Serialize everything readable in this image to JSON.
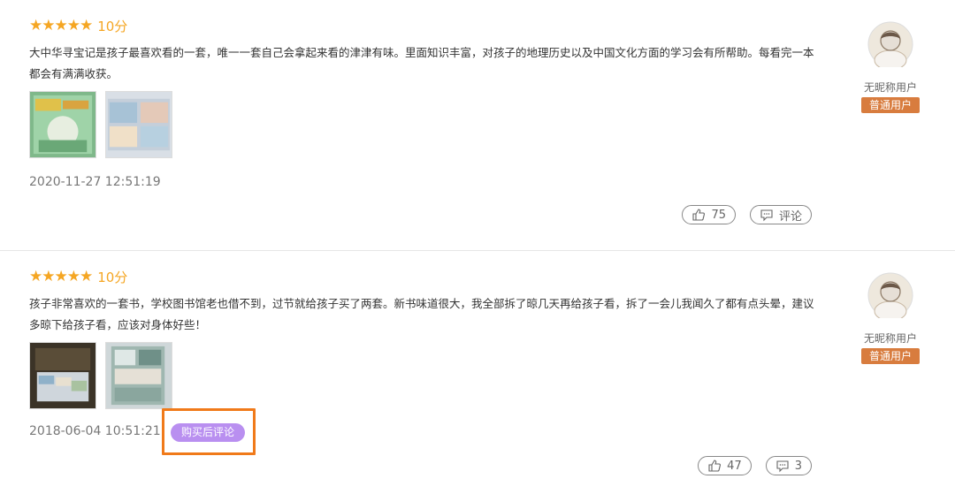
{
  "reviews": [
    {
      "stars": "★★★★★",
      "score": "10分",
      "content": "大中华寻宝记是孩子最喜欢看的一套，唯一一套自己会拿起来看的津津有味。里面知识丰富，对孩子的地理历史以及中国文化方面的学习会有所帮助。每看完一本都会有满满收获。",
      "date": "2020-11-27 12:51:19",
      "likes": "75",
      "comment_label": "评论",
      "user_name": "无昵称用户",
      "user_level": "普通用户"
    },
    {
      "stars": "★★★★★",
      "score": "10分",
      "content": "孩子非常喜欢的一套书，学校图书馆老也借不到，过节就给孩子买了两套。新书味道很大，我全部拆了晾几天再给孩子看，拆了一会儿我闻久了都有点头晕，建议多晾下给孩子看，应该对身体好些！",
      "date": "2018-06-04 10:51:21",
      "badge": "购买后评论",
      "likes": "47",
      "comments": "3",
      "user_name": "无昵称用户",
      "user_level": "普通用户"
    }
  ],
  "colors": {
    "star": "#f5a623",
    "badge": "#b98ff0",
    "highlight": "#f07a1a",
    "user_level_bg": "#d87c3e"
  },
  "icons": [
    "thumbs-up-icon",
    "comment-icon",
    "avatar-icon",
    "star-icon"
  ]
}
